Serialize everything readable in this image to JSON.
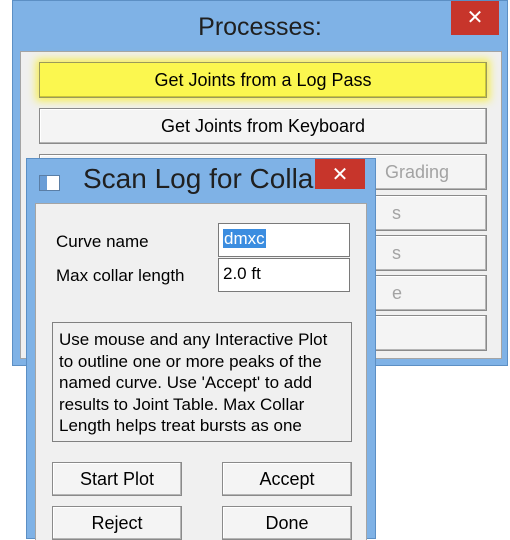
{
  "processes_window": {
    "title": "Processes:",
    "close_glyph": "✕",
    "buttons": [
      {
        "label": "Get Joints from a Log Pass",
        "highlighted": true
      },
      {
        "label": "Get Joints from Keyboard"
      },
      {
        "label": "Grading",
        "disabled": true
      },
      {
        "label": "s",
        "disabled": true
      },
      {
        "label": "s",
        "disabled": true
      },
      {
        "label": "e",
        "disabled": true
      },
      {
        "label": ""
      }
    ]
  },
  "scan_dialog": {
    "title": "Scan Log for Collars",
    "icon": "window-icon",
    "close_glyph": "✕",
    "curve_name_label": "Curve name",
    "curve_name_value": "dmxc",
    "max_collar_label": "Max collar length",
    "max_collar_value": "2.0 ft",
    "description": "Use mouse and any Interactive Plot\nto outline one or more peaks of the\nnamed curve. Use 'Accept' to add\nresults to Joint Table. Max Collar\nLength helps treat bursts as one\ncollar.",
    "buttons": {
      "start_plot": "Start Plot",
      "accept": "Accept",
      "reject": "Reject",
      "done": "Done"
    }
  },
  "colors": {
    "title_bar": "#7fb2e6",
    "close_button": "#c7352b",
    "highlight": "#fbf74f",
    "selection": "#3b8de0"
  }
}
